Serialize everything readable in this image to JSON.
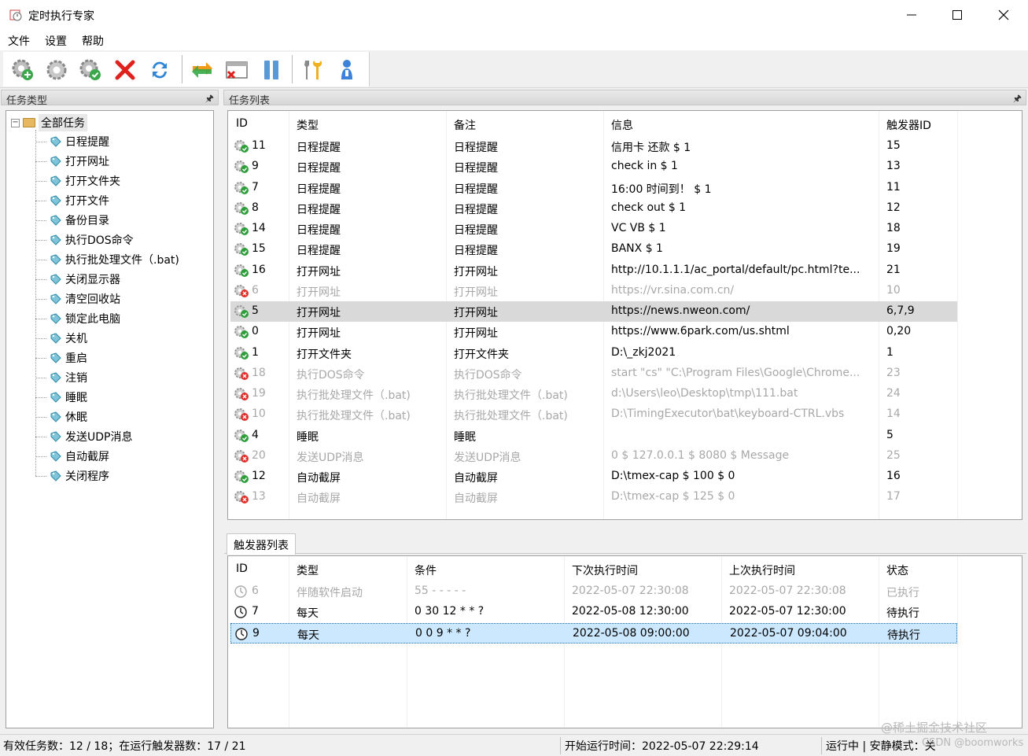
{
  "window": {
    "title": "定时执行专家"
  },
  "menu": [
    "文件",
    "设置",
    "帮助"
  ],
  "toolbar": [
    {
      "icon": "add-gear-icon"
    },
    {
      "icon": "gear-icon"
    },
    {
      "icon": "check-gear-icon"
    },
    {
      "icon": "delete-x-icon"
    },
    {
      "icon": "refresh-icon"
    },
    {
      "icon": "switch-arrows-icon"
    },
    {
      "icon": "close-window-icon"
    },
    {
      "icon": "pause-icon"
    },
    {
      "icon": "tools-icon"
    },
    {
      "icon": "user-icon"
    }
  ],
  "left_pane": {
    "header": "任务类型",
    "pin": "🖈",
    "root": "全部任务",
    "items": [
      "日程提醒",
      "打开网址",
      "打开文件夹",
      "打开文件",
      "备份目录",
      "执行DOS命令",
      "执行批处理文件（.bat)",
      "关闭显示器",
      "清空回收站",
      "锁定此电脑",
      "关机",
      "重启",
      "注销",
      "睡眠",
      "休眠",
      "发送UDP消息",
      "自动截屏",
      "关闭程序"
    ]
  },
  "task_pane": {
    "header": "任务列表",
    "pin": "🖈",
    "columns": [
      "ID",
      "类型",
      "备注",
      "信息",
      "触发器ID"
    ],
    "rows": [
      {
        "id": "11",
        "type": "日程提醒",
        "note": "日程提醒",
        "info": "信用卡 还款 $ 1",
        "trig": "15",
        "status": "ok"
      },
      {
        "id": "9",
        "type": "日程提醒",
        "note": "日程提醒",
        "info": "check in $ 1",
        "trig": "13",
        "status": "ok"
      },
      {
        "id": "7",
        "type": "日程提醒",
        "note": "日程提醒",
        "info": "16:00 时间到！ $ 1",
        "trig": "11",
        "status": "ok"
      },
      {
        "id": "8",
        "type": "日程提醒",
        "note": "日程提醒",
        "info": "check out $ 1",
        "trig": "12",
        "status": "ok"
      },
      {
        "id": "14",
        "type": "日程提醒",
        "note": "日程提醒",
        "info": "VC VB $ 1",
        "trig": "18",
        "status": "ok"
      },
      {
        "id": "15",
        "type": "日程提醒",
        "note": "日程提醒",
        "info": "BANX $ 1",
        "trig": "19",
        "status": "ok"
      },
      {
        "id": "16",
        "type": "打开网址",
        "note": "打开网址",
        "info": "http://10.1.1.1/ac_portal/default/pc.html?te...",
        "trig": "21",
        "status": "ok"
      },
      {
        "id": "6",
        "type": "打开网址",
        "note": "打开网址",
        "info": "https://vr.sina.com.cn/",
        "trig": "10",
        "status": "disabled"
      },
      {
        "id": "5",
        "type": "打开网址",
        "note": "打开网址",
        "info": "https://news.nweon.com/",
        "trig": "6,7,9",
        "status": "selected"
      },
      {
        "id": "0",
        "type": "打开网址",
        "note": "打开网址",
        "info": "https://www.6park.com/us.shtml",
        "trig": "0,20",
        "status": "ok"
      },
      {
        "id": "1",
        "type": "打开文件夹",
        "note": "打开文件夹",
        "info": "D:\\_zkj2021",
        "trig": "1",
        "status": "ok"
      },
      {
        "id": "18",
        "type": "执行DOS命令",
        "note": "执行DOS命令",
        "info": "start \"cs\" \"C:\\Program Files\\Google\\Chrome...",
        "trig": "23",
        "status": "disabled"
      },
      {
        "id": "19",
        "type": "执行批处理文件（.bat)",
        "note": "执行批处理文件（.bat)",
        "info": "d:\\Users\\leo\\Desktop\\tmp\\111.bat",
        "trig": "24",
        "status": "disabled"
      },
      {
        "id": "10",
        "type": "执行批处理文件（.bat)",
        "note": "执行批处理文件（.bat)",
        "info": "D:\\TimingExecutor\\bat\\keyboard-CTRL.vbs",
        "trig": "14",
        "status": "disabled"
      },
      {
        "id": "4",
        "type": "睡眠",
        "note": "睡眠",
        "info": "",
        "trig": "5",
        "status": "ok"
      },
      {
        "id": "20",
        "type": "发送UDP消息",
        "note": "发送UDP消息",
        "info": "0 $ 127.0.0.1 $ 8080 $ Message",
        "trig": "25",
        "status": "disabled"
      },
      {
        "id": "12",
        "type": "自动截屏",
        "note": "自动截屏",
        "info": "D:\\tmex-cap $ 100 $ 0",
        "trig": "16",
        "status": "ok"
      },
      {
        "id": "13",
        "type": "自动截屏",
        "note": "自动截屏",
        "info": "D:\\tmex-cap $ 125 $ 0",
        "trig": "17",
        "status": "disabled"
      }
    ]
  },
  "trigger_pane": {
    "tab": "触发器列表",
    "columns": [
      "ID",
      "类型",
      "条件",
      "下次执行时间",
      "上次执行时间",
      "状态"
    ],
    "rows": [
      {
        "id": "6",
        "type": "伴随软件启动",
        "cond": "55 - - - - -",
        "next": "2022-05-07 22:30:08",
        "last": "2022-05-07 22:30:08",
        "state": "已执行",
        "status": "disabled"
      },
      {
        "id": "7",
        "type": "每天",
        "cond": "0 30 12 * * ?",
        "next": "2022-05-08 12:30:00",
        "last": "2022-05-07 12:30:00",
        "state": "待执行",
        "status": "ok"
      },
      {
        "id": "9",
        "type": "每天",
        "cond": "0 0 9 * * ?",
        "next": "2022-05-08 09:00:00",
        "last": "2022-05-07 09:04:00",
        "state": "待执行",
        "status": "selected"
      }
    ]
  },
  "statusbar": {
    "tasks": "有效任务数：12 / 18；在运行触发器数：17 / 21",
    "start": "开始运行时间：2022-05-07 22:29:14",
    "mode": "运行中 | 安静模式：关"
  },
  "watermark": {
    "line1": "@稀土掘金技术社区",
    "line2": "CSDN @boomworks"
  },
  "colors": {
    "selected_blue": "#cce8ff",
    "selected_gray": "#d9d9d9",
    "disabled_text": "#a8a8a8",
    "ok_badge": "#2e9e3a",
    "error_badge": "#e0302a"
  }
}
